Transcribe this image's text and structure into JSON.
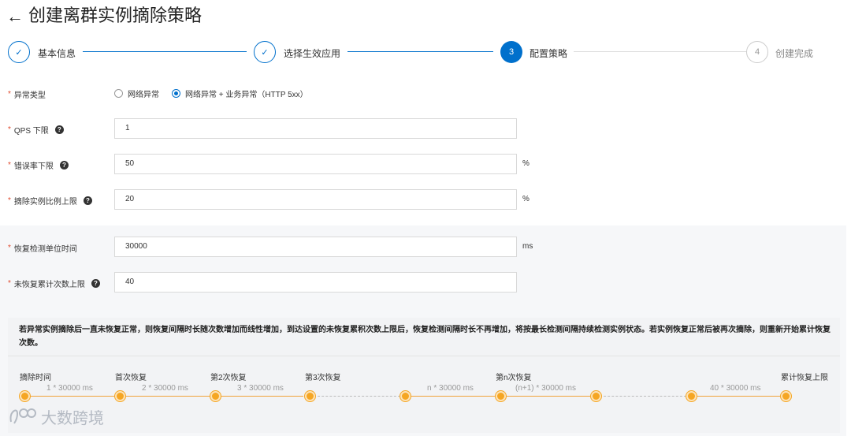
{
  "header": {
    "back_icon": "arrow-left-icon",
    "title": "创建离群实例摘除策略"
  },
  "steps": [
    {
      "label": "基本信息",
      "state": "done",
      "marker": "✓"
    },
    {
      "label": "选择生效应用",
      "state": "done",
      "marker": "✓"
    },
    {
      "label": "配置策略",
      "state": "active",
      "marker": "3"
    },
    {
      "label": "创建完成",
      "state": "pending",
      "marker": "4"
    }
  ],
  "form": {
    "required_mark": "*",
    "help_mark": "?",
    "exception_type": {
      "label": "异常类型",
      "options": [
        {
          "label": "网络异常",
          "checked": false
        },
        {
          "label": "网络异常 + 业务异常（HTTP 5xx）",
          "checked": true
        }
      ]
    },
    "qps_lower": {
      "label": "QPS 下限",
      "value": "1"
    },
    "error_rate_lower": {
      "label": "错误率下限",
      "value": "50",
      "unit": "%"
    },
    "eject_ratio_upper": {
      "label": "摘除实例比例上限",
      "value": "20",
      "unit": "%"
    },
    "recovery_interval": {
      "label": "恢复检测单位时间",
      "value": "30000",
      "unit": "ms"
    },
    "max_unrecovered": {
      "label": "未恢复累计次数上限",
      "value": "40"
    }
  },
  "note": "若异常实例摘除后一直未恢复正常，则恢复间隔时长随次数增加而线性增加，到达设置的未恢复累积次数上限后，恢复检测间隔时长不再增加，将按最长检测间隔持续检测实例状态。若实例恢复正常后被再次摘除，则重新开始累计恢复次数。",
  "timeline": {
    "labels": [
      "摘除时间",
      "首次恢复",
      "第2次恢复",
      "第3次恢复",
      "第n次恢复",
      "累计恢复上限"
    ],
    "intervals": [
      "1 * 30000 ms",
      "2 * 30000 ms",
      "3 * 30000 ms",
      "n * 30000 ms",
      "(n+1) * 30000 ms",
      "40 * 30000 ms"
    ]
  },
  "watermark": {
    "text": "大数跨境",
    "icon": "brand-logo-icon"
  },
  "colors": {
    "primary": "#0070cc",
    "timeline": "#f5a623",
    "required": "#e04b2f"
  }
}
